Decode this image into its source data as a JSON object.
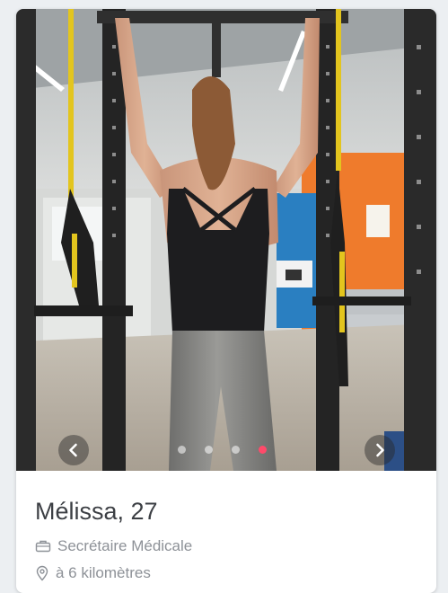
{
  "profile": {
    "name_age": "Mélissa, 27",
    "job": "Secrétaire Médicale",
    "distance": "à 6 kilomètres"
  },
  "photo_carousel": {
    "total": 4,
    "active_index": 3,
    "prev_icon": "chevron-left-icon",
    "next_icon": "chevron-right-icon"
  },
  "icons": {
    "job": "briefcase-icon",
    "distance": "map-pin-icon"
  },
  "colors": {
    "active_dot": "#ff4a6a",
    "name_text": "#3c3f44",
    "meta_text": "#8d9197"
  }
}
